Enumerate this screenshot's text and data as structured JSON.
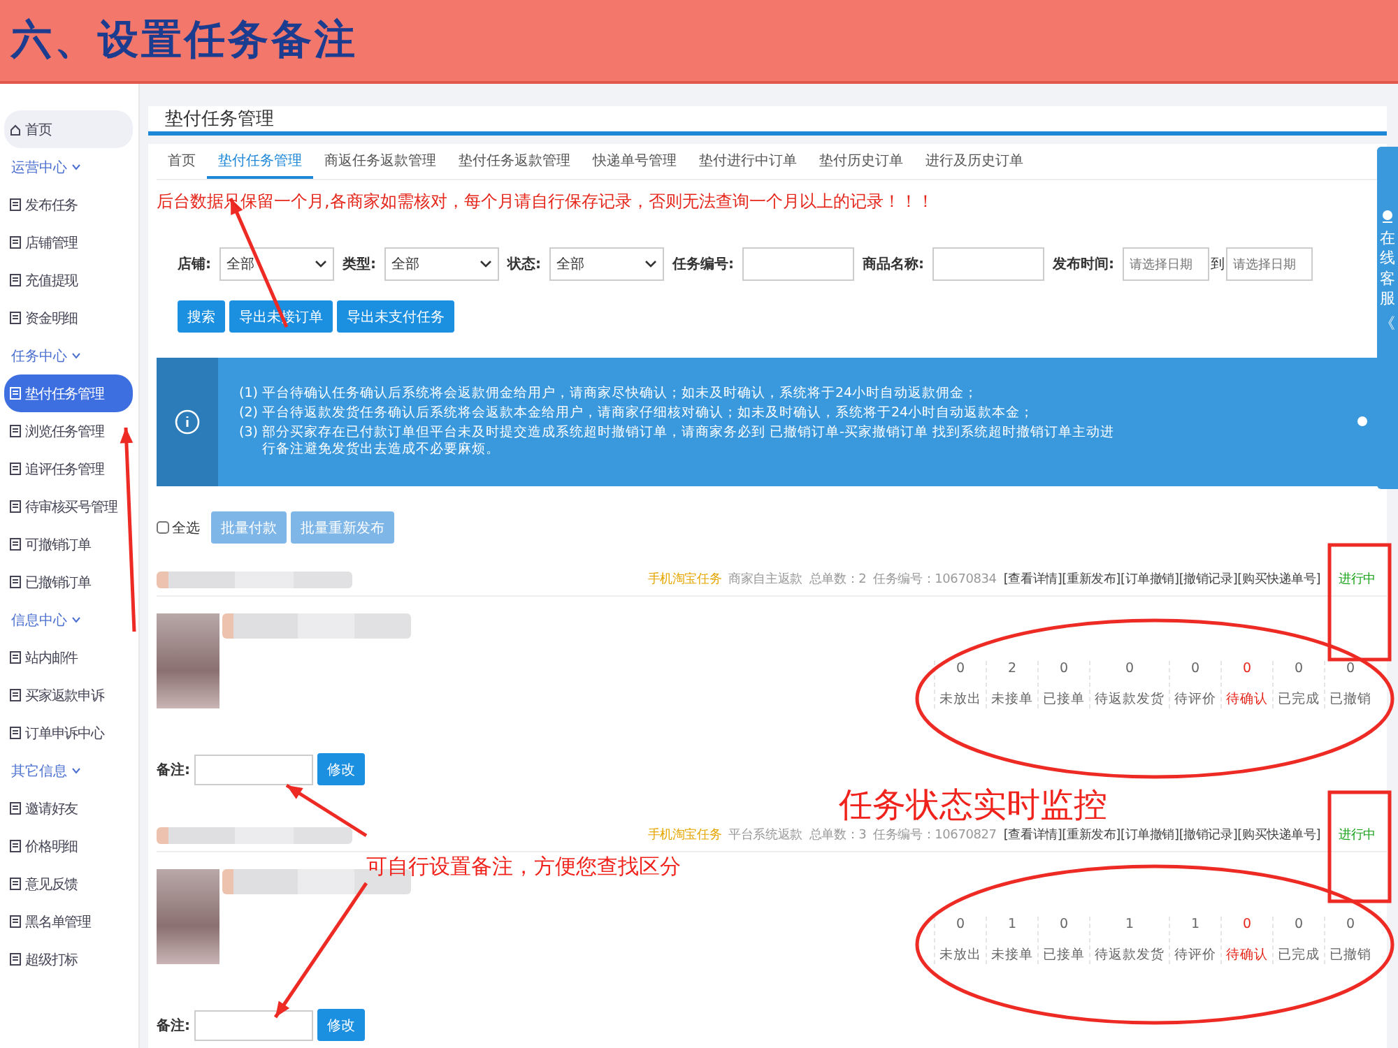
{
  "banner": {
    "title": "六、设置任务备注"
  },
  "sidebar": {
    "home": {
      "label": "首页",
      "selected": false
    },
    "sections": [
      {
        "title": "运营中心",
        "expanded": true,
        "items": [
          {
            "label": "发布任务",
            "selected": false
          },
          {
            "label": "店铺管理",
            "selected": false
          },
          {
            "label": "充值提现",
            "selected": false
          },
          {
            "label": "资金明细",
            "selected": false
          }
        ]
      },
      {
        "title": "任务中心",
        "expanded": true,
        "items": [
          {
            "label": "垫付任务管理",
            "selected": true
          },
          {
            "label": "浏览任务管理",
            "selected": false
          },
          {
            "label": "追评任务管理",
            "selected": false
          },
          {
            "label": "待审核买号管理",
            "selected": false
          },
          {
            "label": "可撤销订单",
            "selected": false
          },
          {
            "label": "已撤销订单",
            "selected": false
          }
        ]
      },
      {
        "title": "信息中心",
        "expanded": true,
        "items": [
          {
            "label": "站内邮件",
            "selected": false
          },
          {
            "label": "买家返款申诉",
            "selected": false
          },
          {
            "label": "订单申诉中心",
            "selected": false
          }
        ]
      },
      {
        "title": "其它信息",
        "expanded": true,
        "items": [
          {
            "label": "邀请好友",
            "selected": false
          },
          {
            "label": "价格明细",
            "selected": false
          },
          {
            "label": "意见反馈",
            "selected": false
          },
          {
            "label": "黑名单管理",
            "selected": false
          },
          {
            "label": "超级打标",
            "selected": false
          }
        ]
      }
    ]
  },
  "page_title": "垫付任务管理",
  "tabs": [
    {
      "label": "首页",
      "selected": false
    },
    {
      "label": "垫付任务管理",
      "selected": true
    },
    {
      "label": "商返任务返款管理",
      "selected": false
    },
    {
      "label": "垫付任务返款管理",
      "selected": false
    },
    {
      "label": "快递单号管理",
      "selected": false
    },
    {
      "label": "垫付进行中订单",
      "selected": false
    },
    {
      "label": "垫付历史订单",
      "selected": false
    },
    {
      "label": "进行及历史订单",
      "selected": false
    }
  ],
  "notice": "后台数据只保留一个月,各商家如需核对，每个月请自行保存记录，否则无法查询一个月以上的记录！！！",
  "filters": [
    {
      "kind": "select",
      "label": "店铺:",
      "value": "全部"
    },
    {
      "kind": "select",
      "label": "类型:",
      "value": "全部"
    },
    {
      "kind": "select",
      "label": "状态:",
      "value": "全部"
    },
    {
      "kind": "text",
      "label": "任务编号:"
    },
    {
      "kind": "text",
      "label": "商品名称:"
    },
    {
      "kind": "daterange",
      "label": "发布时间:",
      "placeholder": "请选择日期",
      "separator": "到",
      "placeholder_end": "请选择日期"
    }
  ],
  "buttons": [
    "搜索",
    "导出未接订单",
    "导出未支付任务"
  ],
  "info": [
    {
      "num": "(1)",
      "text": "平台待确认任务确认后系统将会返款佣金给用户，请商家尽快确认；如未及时确认，系统将于24小时自动返款佣金；"
    },
    {
      "num": "(2)",
      "text": "平台待返款发货任务确认后系统将会返款本金给用户，请商家仔细核对确认；如未及时确认，系统将于24小时自动返款本金；"
    },
    {
      "num": "(3)",
      "text": "部分买家存在已付款订单但平台未及时提交造成系统超时撤销订单，请商家务必到 已撤销订单-买家撤销订单 找到系统超时撤销订单主动进行备注避免发货出去造成不必要麻烦。"
    }
  ],
  "select_all": {
    "label": "全选",
    "checked": false
  },
  "batch_buttons": [
    "批量付款",
    "批量重新发布"
  ],
  "tasks": [
    {
      "platform": "手机淘宝任务",
      "refund_type": "商家自主返款",
      "total": "总单数：2",
      "task_no": "任务编号：10670834",
      "actions": [
        "[查看详情]",
        "[重新发布]",
        "[订单撤销]",
        "[撤销记录]",
        "[购买快递单号]"
      ],
      "status": "进行中",
      "stats": [
        {
          "value": "0",
          "label": "未放出",
          "alert": false
        },
        {
          "value": "2",
          "label": "未接单",
          "alert": false
        },
        {
          "value": "0",
          "label": "已接单",
          "alert": false
        },
        {
          "value": "0",
          "label": "待返款发货",
          "alert": false
        },
        {
          "value": "0",
          "label": "待评价",
          "alert": false
        },
        {
          "value": "0",
          "label": "待确认",
          "alert": true
        },
        {
          "value": "0",
          "label": "已完成",
          "alert": false
        },
        {
          "value": "0",
          "label": "已撤销",
          "alert": false
        }
      ],
      "remark_label": "备注:",
      "remark_button": "修改"
    },
    {
      "platform": "手机淘宝任务",
      "refund_type": "平台系统返款",
      "total": "总单数：3",
      "task_no": "任务编号：10670827",
      "actions": [
        "[查看详情]",
        "[重新发布]",
        "[订单撤销]",
        "[撤销记录]",
        "[购买快递单号]"
      ],
      "status": "进行中",
      "stats": [
        {
          "value": "0",
          "label": "未放出",
          "alert": false
        },
        {
          "value": "1",
          "label": "未接单",
          "alert": false
        },
        {
          "value": "0",
          "label": "已接单",
          "alert": false
        },
        {
          "value": "1",
          "label": "待返款发货",
          "alert": false
        },
        {
          "value": "1",
          "label": "待评价",
          "alert": false
        },
        {
          "value": "0",
          "label": "待确认",
          "alert": true
        },
        {
          "value": "0",
          "label": "已完成",
          "alert": false
        },
        {
          "value": "0",
          "label": "已撤销",
          "alert": false
        }
      ],
      "remark_label": "备注:",
      "remark_button": "修改"
    }
  ],
  "service_tab": {
    "label": "在线客服",
    "arrow": "《"
  },
  "annotations": {
    "status_callout": "任务状态实时监控",
    "remark_callout": "可自行设置备注，方便您查找区分"
  }
}
